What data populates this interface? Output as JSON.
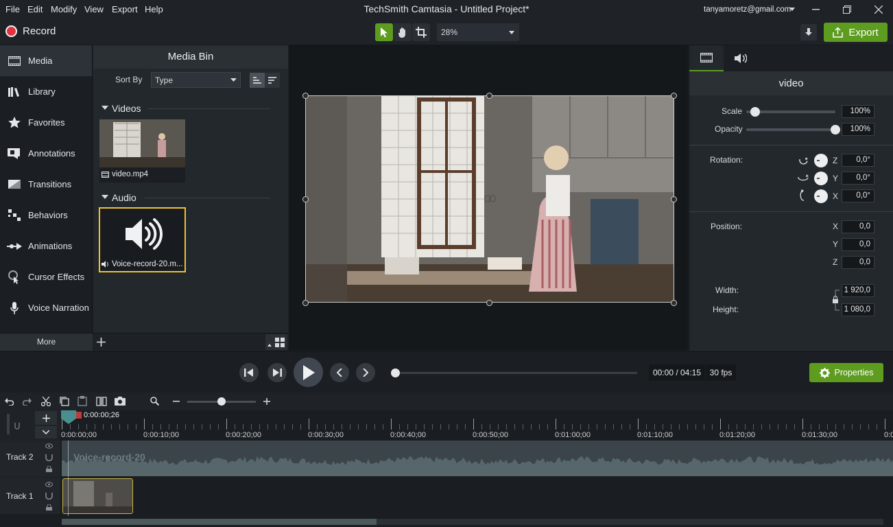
{
  "app": {
    "title": "TechSmith Camtasia - Untitled Project*",
    "menu": [
      "File",
      "Edit",
      "Modify",
      "View",
      "Export",
      "Help"
    ],
    "account": "tanyamoretz@gmail.com"
  },
  "toolbar": {
    "record_label": "Record",
    "zoom": "28%",
    "export_label": "Export"
  },
  "nav": {
    "items": [
      "Media",
      "Library",
      "Favorites",
      "Annotations",
      "Transitions",
      "Behaviors",
      "Animations",
      "Cursor Effects",
      "Voice Narration"
    ],
    "more_label": "More"
  },
  "bin": {
    "title": "Media Bin",
    "sort_label": "Sort By",
    "sort_value": "Type",
    "videos_label": "Videos",
    "audio_label": "Audio",
    "video_file": "video.mp4",
    "audio_file": "Voice-record-20.m..."
  },
  "props": {
    "title": "video",
    "scale_label": "Scale",
    "scale_value": "100%",
    "scale_level": 0.1,
    "opacity_label": "Opacity",
    "opacity_value": "100%",
    "opacity_level": 1.0,
    "rotation_label": "Rotation:",
    "rot_z": "0,0°",
    "rot_y": "0,0°",
    "rot_x": "0,0°",
    "position_label": "Position:",
    "pos_x": "0,0",
    "pos_y": "0,0",
    "pos_z": "0,0",
    "width_label": "Width:",
    "width_value": "1 920,0",
    "height_label": "Height:",
    "height_value": "1 080,0",
    "axis_x": "X",
    "axis_y": "Y",
    "axis_z": "Z"
  },
  "transport": {
    "time": "00:00 / 04:15",
    "fps": "30 fps",
    "properties_label": "Properties"
  },
  "timeline": {
    "playhead": "0:00:00;26",
    "ticks": [
      "0:00:00;00",
      "0:00:10;00",
      "0:00:20;00",
      "0:00:30;00",
      "0:00:40;00",
      "0:00:50;00",
      "0:01:00;00",
      "0:01:10;00",
      "0:01:20;00",
      "0:01:30;00",
      "0:0"
    ],
    "track2": "Track 2",
    "track1": "Track 1",
    "clip_audio": "Voice-record-20"
  },
  "colors": {
    "accent_green": "#5e9c20",
    "record_red": "#e0333f",
    "selection_yellow": "#f2c230"
  }
}
